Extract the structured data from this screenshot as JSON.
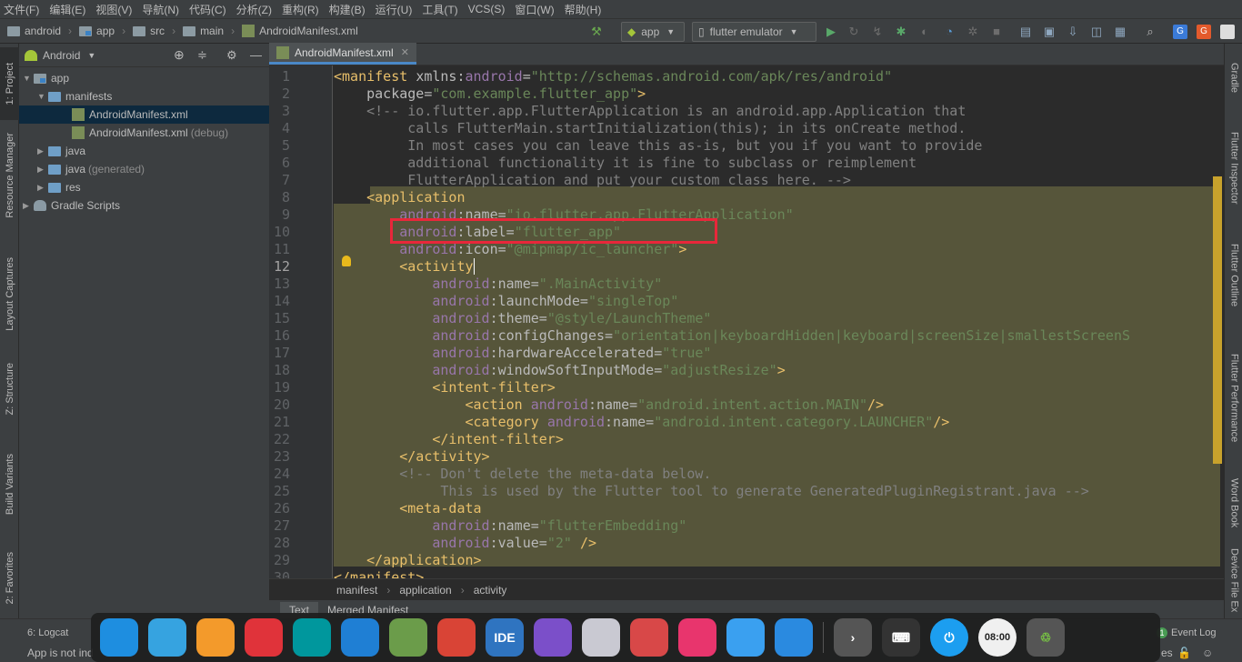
{
  "menu": [
    "文件(F)",
    "编辑(E)",
    "视图(V)",
    "导航(N)",
    "代码(C)",
    "分析(Z)",
    "重构(R)",
    "构建(B)",
    "运行(U)",
    "工具(T)",
    "VCS(S)",
    "窗口(W)",
    "帮助(H)"
  ],
  "navbar": {
    "crumbs": [
      "android",
      "app",
      "src",
      "main",
      "AndroidManifest.xml"
    ],
    "run_config": "app",
    "device": "flutter emulator"
  },
  "left_tabs": [
    "1: Project",
    "Resource Manager",
    "Layout Captures",
    "Z: Structure",
    "Build Variants",
    "2: Favorites"
  ],
  "right_tabs": [
    "Gradle",
    "Flutter Inspector",
    "Flutter Outline",
    "Flutter Performance",
    "Word Book",
    "Device File Ex"
  ],
  "project": {
    "view_mode": "Android",
    "tree": [
      {
        "label": "app",
        "hint": ""
      },
      {
        "label": "manifests",
        "hint": ""
      },
      {
        "label": "AndroidManifest.xml",
        "hint": ""
      },
      {
        "label": "AndroidManifest.xml",
        "hint": "(debug)"
      },
      {
        "label": "java",
        "hint": ""
      },
      {
        "label": "java",
        "hint": "(generated)"
      },
      {
        "label": "res",
        "hint": ""
      },
      {
        "label": "Gradle Scripts",
        "hint": ""
      }
    ]
  },
  "editor": {
    "tab": "AndroidManifest.xml",
    "current_line": 12,
    "line_numbers": [
      "1",
      "2",
      "3",
      "4",
      "5",
      "6",
      "7",
      "8",
      "9",
      "10",
      "11",
      "12",
      "13",
      "14",
      "15",
      "16",
      "17",
      "18",
      "19",
      "20",
      "21",
      "22",
      "23",
      "24",
      "25",
      "26",
      "27",
      "28",
      "29",
      "30"
    ],
    "lines": [
      [
        [
          "t-tag",
          "<manifest "
        ],
        [
          "t-attr",
          "xmlns:"
        ],
        [
          "t-ns",
          "android"
        ],
        [
          "t-attr",
          "="
        ],
        [
          "t-val",
          "\"http://schemas.android.com/apk/res/android\""
        ]
      ],
      [
        [
          "t-attr",
          "    package"
        ],
        [
          "t-attr",
          "="
        ],
        [
          "t-val",
          "\"com.example.flutter_app\""
        ],
        [
          "t-tag",
          ">"
        ]
      ],
      [
        [
          "t-com",
          "    <!-- io.flutter.app.FlutterApplication is an android.app.Application that"
        ]
      ],
      [
        [
          "t-com",
          "         calls FlutterMain.startInitialization(this); in its onCreate method."
        ]
      ],
      [
        [
          "t-com",
          "         In most cases you can leave this as-is, but you if you want to provide"
        ]
      ],
      [
        [
          "t-com",
          "         additional functionality it is fine to subclass or reimplement"
        ]
      ],
      [
        [
          "t-com",
          "         FlutterApplication and put your custom class here. -->"
        ]
      ],
      [
        [
          "t-tag",
          "    <application"
        ]
      ],
      [
        [
          "t-ns",
          "        android"
        ],
        [
          "t-attr",
          ":name="
        ],
        [
          "t-val",
          "\"io.flutter.app.FlutterApplication\""
        ]
      ],
      [
        [
          "t-ns",
          "        android"
        ],
        [
          "t-attr",
          ":label="
        ],
        [
          "t-val",
          "\"flutter_app\""
        ]
      ],
      [
        [
          "t-ns",
          "        android"
        ],
        [
          "t-attr",
          ":icon="
        ],
        [
          "t-val",
          "\"@mipmap/ic_launcher\""
        ],
        [
          "t-tag",
          ">"
        ]
      ],
      [
        [
          "t-tag",
          "        <"
        ],
        [
          "t-cur",
          "activity"
        ]
      ],
      [
        [
          "t-ns",
          "            android"
        ],
        [
          "t-attr",
          ":name="
        ],
        [
          "t-val",
          "\".MainActivity\""
        ]
      ],
      [
        [
          "t-ns",
          "            android"
        ],
        [
          "t-attr",
          ":launchMode="
        ],
        [
          "t-val",
          "\"singleTop\""
        ]
      ],
      [
        [
          "t-ns",
          "            android"
        ],
        [
          "t-attr",
          ":theme="
        ],
        [
          "t-val",
          "\"@style/LaunchTheme\""
        ]
      ],
      [
        [
          "t-ns",
          "            android"
        ],
        [
          "t-attr",
          ":configChanges="
        ],
        [
          "t-val",
          "\"orientation|keyboardHidden|keyboard|screenSize|smallestScreenS"
        ]
      ],
      [
        [
          "t-ns",
          "            android"
        ],
        [
          "t-attr",
          ":hardwareAccelerated="
        ],
        [
          "t-val",
          "\"true\""
        ]
      ],
      [
        [
          "t-ns",
          "            android"
        ],
        [
          "t-attr",
          ":windowSoftInputMode="
        ],
        [
          "t-val",
          "\"adjustResize\""
        ],
        [
          "t-tag",
          ">"
        ]
      ],
      [
        [
          "t-tag",
          "            <intent-filter>"
        ]
      ],
      [
        [
          "t-tag",
          "                <action "
        ],
        [
          "t-ns",
          "android"
        ],
        [
          "t-attr",
          ":name="
        ],
        [
          "t-val",
          "\"android.intent.action.MAIN\""
        ],
        [
          "t-tag",
          "/>"
        ]
      ],
      [
        [
          "t-tag",
          "                <category "
        ],
        [
          "t-ns",
          "android"
        ],
        [
          "t-attr",
          ":name="
        ],
        [
          "t-val",
          "\"android.intent.category.LAUNCHER\""
        ],
        [
          "t-tag",
          "/>"
        ]
      ],
      [
        [
          "t-tag",
          "            </intent-filter>"
        ]
      ],
      [
        [
          "t-tag",
          "        </activity>"
        ]
      ],
      [
        [
          "t-com",
          "        <!-- Don't delete the meta-data below."
        ]
      ],
      [
        [
          "t-com",
          "             This is used by the Flutter tool to generate GeneratedPluginRegistrant.java -->"
        ]
      ],
      [
        [
          "t-tag",
          "        <meta-data"
        ]
      ],
      [
        [
          "t-ns",
          "            android"
        ],
        [
          "t-attr",
          ":name="
        ],
        [
          "t-val",
          "\"flutterEmbedding\""
        ]
      ],
      [
        [
          "t-ns",
          "            android"
        ],
        [
          "t-attr",
          ":value="
        ],
        [
          "t-val",
          "\"2\" "
        ],
        [
          "t-tag",
          "/>"
        ]
      ],
      [
        [
          "t-tag",
          "    </application>"
        ]
      ],
      [
        [
          "t-tag",
          "</manifest>"
        ]
      ]
    ],
    "breadcrumb": [
      "manifest",
      "application",
      "activity"
    ],
    "bottom_tabs": [
      "Text",
      "Merged Manifest"
    ]
  },
  "status": {
    "logcat": "6: Logcat",
    "message": "App is not ind",
    "event_log": "Event Log",
    "event_count": "1",
    "spaces": "es"
  },
  "dock": [
    {
      "name": "deepin-launcher",
      "label": "",
      "color": "#1e8ee0"
    },
    {
      "name": "file-manager",
      "label": "",
      "color": "#36a3e0"
    },
    {
      "name": "app-store",
      "label": "",
      "color": "#f39a2b"
    },
    {
      "name": "netease-music",
      "label": "",
      "color": "#e0333a"
    },
    {
      "name": "arduino",
      "label": "",
      "color": "#00979d"
    },
    {
      "name": "vscode",
      "label": "",
      "color": "#1f7fd4"
    },
    {
      "name": "android-studio",
      "label": "",
      "color": "#6b9c4a"
    },
    {
      "name": "chrome",
      "label": "",
      "color": "#d94436"
    },
    {
      "name": "intellij",
      "label": "IDE",
      "color": "#2f74c0"
    },
    {
      "name": "phpstorm",
      "label": "",
      "color": "#7b4fc9"
    },
    {
      "name": "settings",
      "label": "",
      "color": "#c9c9d2"
    },
    {
      "name": "screen-recorder",
      "label": "",
      "color": "#d84848"
    },
    {
      "name": "screenshot",
      "label": "",
      "color": "#e8356d"
    },
    {
      "name": "wps",
      "label": "",
      "color": "#3aa0f0"
    },
    {
      "name": "xmind",
      "label": "",
      "color": "#2a8ae0"
    }
  ],
  "tray": {
    "clock": "08:00"
  }
}
